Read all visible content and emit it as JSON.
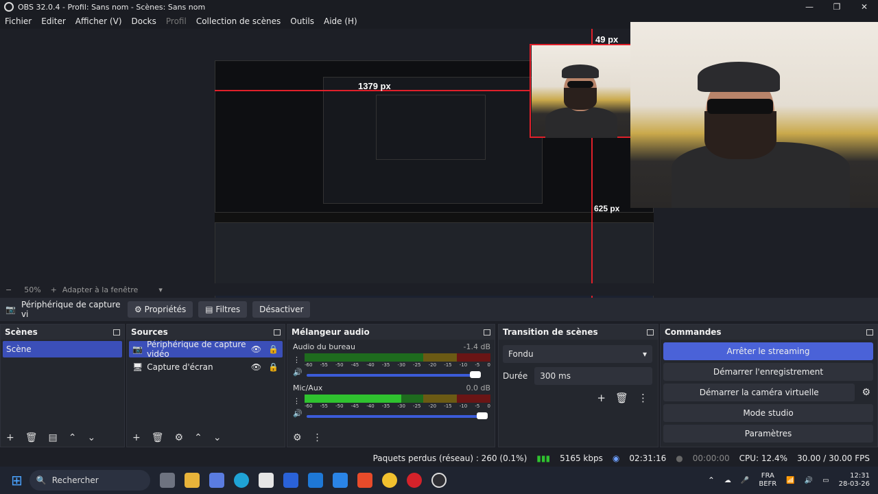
{
  "window": {
    "title": "OBS 32.0.4 - Profil: Sans nom - Scènes: Sans nom"
  },
  "menu": [
    "Fichier",
    "Editer",
    "Afficher (V)",
    "Docks",
    "Profil",
    "Collection de scènes",
    "Outils",
    "Aide (H)"
  ],
  "preview": {
    "measure_top": "49 px",
    "measure_left": "1379 px",
    "measure_bottom": "625 px"
  },
  "zoom": {
    "value": "50%",
    "fit_label": "Adapter à la fenêtre"
  },
  "sourcebar": {
    "source_name": "Périphérique de capture vi",
    "properties": "Propriétés",
    "filters": "Filtres",
    "deactivate": "Désactiver"
  },
  "docks": {
    "scenes": {
      "title": "Scènes",
      "items": [
        "Scène"
      ]
    },
    "sources": {
      "title": "Sources",
      "items": [
        "Périphérique de capture vidéo",
        "Capture d'écran"
      ]
    },
    "mixer": {
      "title": "Mélangeur audio",
      "channels": [
        {
          "name": "Audio du bureau",
          "db": "-1.4 dB"
        },
        {
          "name": "Mic/Aux",
          "db": "0.0 dB"
        }
      ],
      "ticks": [
        "-60",
        "-55",
        "-50",
        "-45",
        "-40",
        "-35",
        "-30",
        "-25",
        "-20",
        "-15",
        "-10",
        "-5",
        "0"
      ]
    },
    "transition": {
      "title": "Transition de scènes",
      "type": "Fondu",
      "duration_label": "Durée",
      "duration_value": "300 ms"
    },
    "commands": {
      "title": "Commandes",
      "buttons": [
        "Arrêter le streaming",
        "Démarrer l'enregistrement",
        "Démarrer la caméra virtuelle",
        "Mode studio",
        "Paramètres"
      ]
    }
  },
  "status": {
    "dropped": "Paquets perdus (réseau) : 260 (0.1%)",
    "bitrate": "5165 kbps",
    "stream_time": "02:31:16",
    "rec_time": "00:00:00",
    "cpu": "CPU: 12.4%",
    "fps": "30.00 / 30.00 FPS"
  },
  "taskbar": {
    "search_placeholder": "Rechercher",
    "lang": "FRA",
    "layout": "BEFR",
    "time": "12:31",
    "date": "28-03-26"
  },
  "colors": {
    "accent": "#3b4fb8",
    "measure": "#e0202a",
    "meter_green": "#2fc22f",
    "meter_yellow": "#c9a227",
    "meter_red": "#c42a2a"
  }
}
